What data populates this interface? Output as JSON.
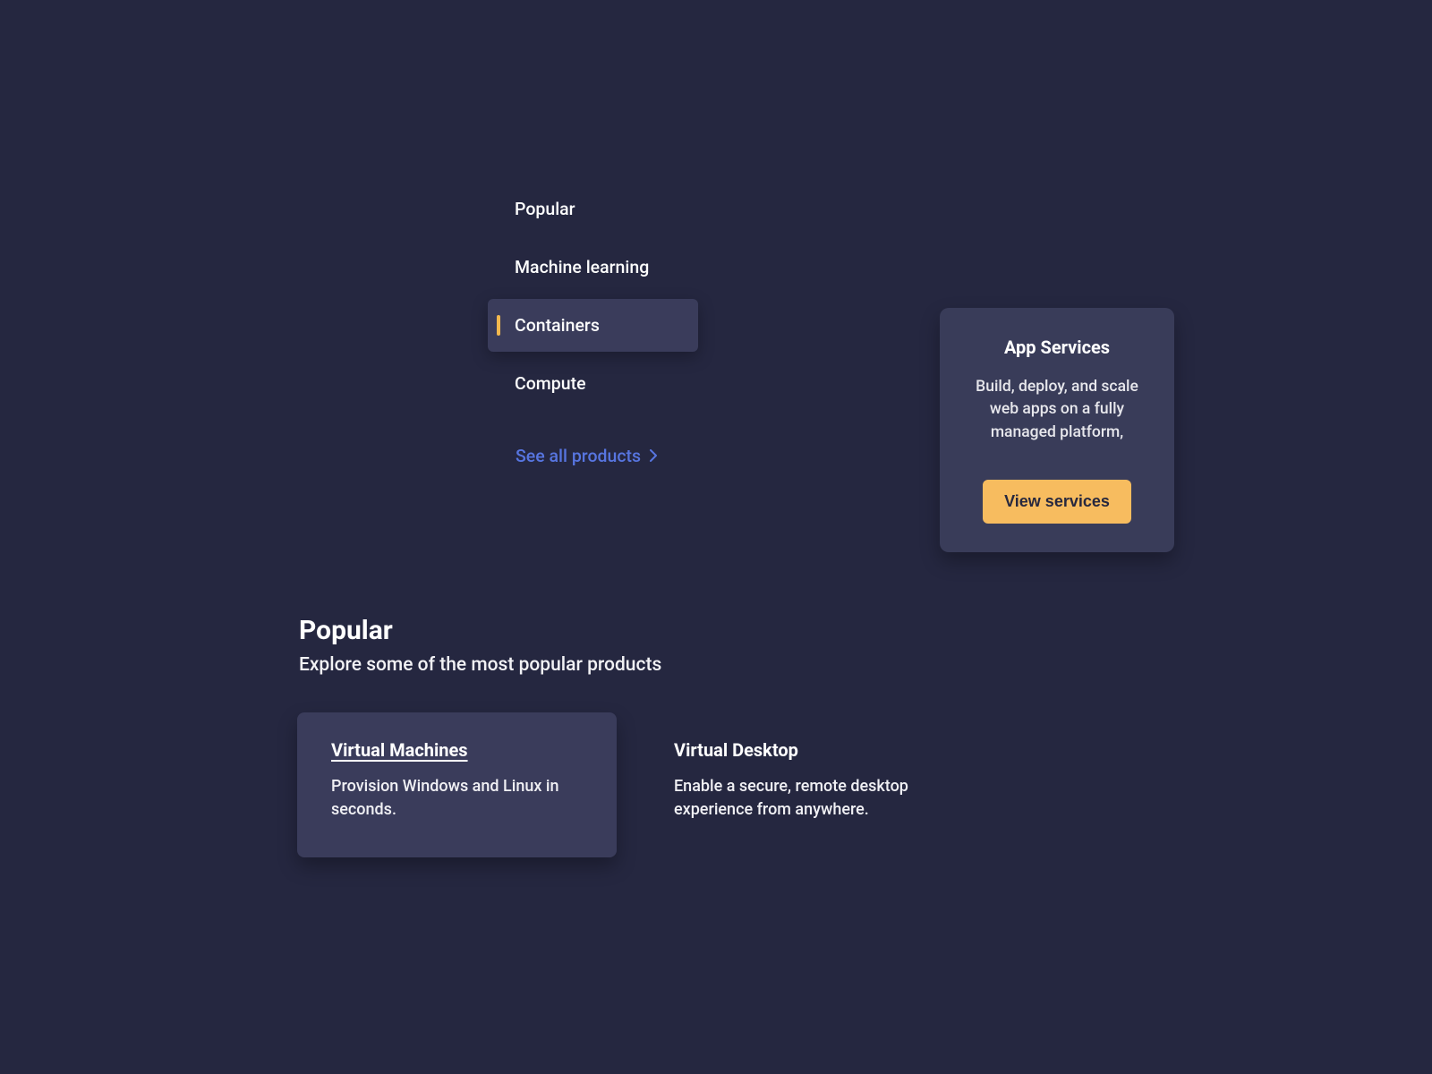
{
  "nav": {
    "items": [
      {
        "label": "Popular",
        "selected": false
      },
      {
        "label": "Machine learning",
        "selected": false
      },
      {
        "label": "Containers",
        "selected": true
      },
      {
        "label": "Compute",
        "selected": false
      }
    ],
    "see_all": "See all products"
  },
  "service_card": {
    "title": "App Services",
    "description": "Build, deploy, and scale web apps on a fully managed platform,",
    "button_label": "View services"
  },
  "popular_section": {
    "title": "Popular",
    "subtitle": "Explore some of the most popular products"
  },
  "products": [
    {
      "title": "Virtual Machines",
      "description": "Provision Windows and Linux in seconds.",
      "highlighted": true
    },
    {
      "title": "Virtual Desktop",
      "description": "Enable a secure, remote desktop experience from anywhere.",
      "highlighted": false
    }
  ]
}
